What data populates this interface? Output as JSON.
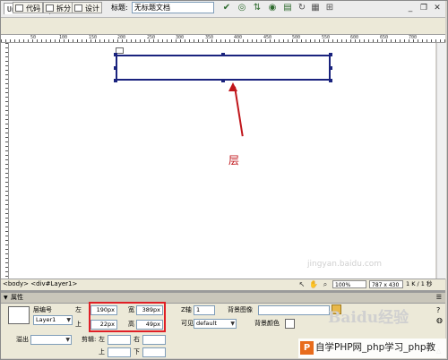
{
  "window": {
    "doc_tab": "Untitled-1*",
    "min": "_",
    "restore": "❐",
    "close": "✕"
  },
  "toolbar": {
    "code_label": "代码",
    "split_label": "拆分",
    "design_label": "设计",
    "title_label": "标题:",
    "title_value": "无标题文档"
  },
  "ruler": {
    "marks": [
      "50",
      "100",
      "150",
      "200",
      "250",
      "300",
      "350",
      "400",
      "450",
      "500",
      "550",
      "600",
      "650",
      "700"
    ]
  },
  "annotation": {
    "text": "层",
    "color": "#c0161b"
  },
  "statusbar": {
    "tags": "<body> <div#Layer1>",
    "zoom": "100%",
    "size": "787 x 430",
    "info": "1 K / 1 秒"
  },
  "props": {
    "panel_title": "属性",
    "layer_id_label": "层编号",
    "layer_id_value": "Layer1",
    "left_label": "左",
    "left_value": "190px",
    "top_label": "上",
    "top_value": "22px",
    "width_label": "宽",
    "width_value": "389px",
    "height_label": "高",
    "height_value": "49px",
    "z_label": "Z轴",
    "z_value": "1",
    "bgimage_label": "背景图像",
    "visibility_label": "可见性",
    "visibility_value": "default",
    "bgcolor_label": "背景颜色",
    "overflow_label": "溢出",
    "clip_label": "剪辑:",
    "clip_left": "左",
    "clip_right": "右",
    "clip_top": "上",
    "clip_bottom": "下"
  },
  "watermarks": {
    "site": "自学PHP网_php学习_php教",
    "logo": "P",
    "baidu": "Baidu经验",
    "jingyan": "jingyan.baidu.com"
  },
  "colors": {
    "layer_border": "#1a237e",
    "highlight": "#e01f26",
    "panel_bg": "#ece9d8"
  }
}
